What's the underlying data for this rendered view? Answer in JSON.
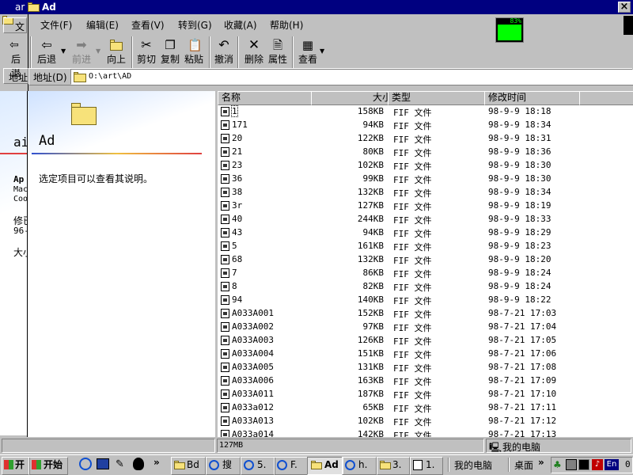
{
  "titlebar": {
    "back_window_title": "ar",
    "title": "Ad",
    "close_glyph": "×"
  },
  "menu": [
    "文",
    "文件(F)",
    "编辑(E)",
    "查看(V)",
    "转到(G)",
    "收藏(A)",
    "帮助(H)"
  ],
  "meter": {
    "value": "83%"
  },
  "toolbar": {
    "left_partial": "后退",
    "buttons": [
      "后退",
      "前进",
      "向上",
      "剪切",
      "复制",
      "粘贴",
      "撤消",
      "删除",
      "属性",
      "查看"
    ]
  },
  "addressbar": {
    "left_label": "地址",
    "label": "地址(D)",
    "path": "O:\\art\\AD"
  },
  "back_window_panel": {
    "title": "ai",
    "line1": "Ap",
    "line2": "Mac",
    "line3": "Coo",
    "line4": "修已",
    "line5": "96-",
    "line6": "大小"
  },
  "left_panel": {
    "folder_title": "Ad",
    "hint": "选定项目可以查看其说明。"
  },
  "columns": {
    "name": "名称",
    "size": "大小",
    "type": "类型",
    "modified": "修改时间"
  },
  "files": [
    {
      "name": "1",
      "size": "158KB",
      "type": "FIF 文件",
      "date": "98-9-9 18:18"
    },
    {
      "name": "171",
      "size": "94KB",
      "type": "FIF 文件",
      "date": "98-9-9 18:34"
    },
    {
      "name": "20",
      "size": "122KB",
      "type": "FIF 文件",
      "date": "98-9-9 18:31"
    },
    {
      "name": "21",
      "size": "80KB",
      "type": "FIF 文件",
      "date": "98-9-9 18:36"
    },
    {
      "name": "23",
      "size": "102KB",
      "type": "FIF 文件",
      "date": "98-9-9 18:30"
    },
    {
      "name": "36",
      "size": "99KB",
      "type": "FIF 文件",
      "date": "98-9-9 18:30"
    },
    {
      "name": "38",
      "size": "132KB",
      "type": "FIF 文件",
      "date": "98-9-9 18:34"
    },
    {
      "name": "3r",
      "size": "127KB",
      "type": "FIF 文件",
      "date": "98-9-9 18:19"
    },
    {
      "name": "40",
      "size": "244KB",
      "type": "FIF 文件",
      "date": "98-9-9 18:33"
    },
    {
      "name": "43",
      "size": "94KB",
      "type": "FIF 文件",
      "date": "98-9-9 18:29"
    },
    {
      "name": "5",
      "size": "161KB",
      "type": "FIF 文件",
      "date": "98-9-9 18:23"
    },
    {
      "name": "68",
      "size": "132KB",
      "type": "FIF 文件",
      "date": "98-9-9 18:20"
    },
    {
      "name": "7",
      "size": "86KB",
      "type": "FIF 文件",
      "date": "98-9-9 18:24"
    },
    {
      "name": "8",
      "size": "82KB",
      "type": "FIF 文件",
      "date": "98-9-9 18:24"
    },
    {
      "name": "94",
      "size": "140KB",
      "type": "FIF 文件",
      "date": "98-9-9 18:22"
    },
    {
      "name": "A033A001",
      "size": "152KB",
      "type": "FIF 文件",
      "date": "98-7-21 17:03"
    },
    {
      "name": "A033A002",
      "size": "97KB",
      "type": "FIF 文件",
      "date": "98-7-21 17:04"
    },
    {
      "name": "A033A003",
      "size": "126KB",
      "type": "FIF 文件",
      "date": "98-7-21 17:05"
    },
    {
      "name": "A033A004",
      "size": "151KB",
      "type": "FIF 文件",
      "date": "98-7-21 17:06"
    },
    {
      "name": "A033A005",
      "size": "131KB",
      "type": "FIF 文件",
      "date": "98-7-21 17:08"
    },
    {
      "name": "A033A006",
      "size": "163KB",
      "type": "FIF 文件",
      "date": "98-7-21 17:09"
    },
    {
      "name": "A033A011",
      "size": "187KB",
      "type": "FIF 文件",
      "date": "98-7-21 17:10"
    },
    {
      "name": "A033a012",
      "size": "65KB",
      "type": "FIF 文件",
      "date": "98-7-21 17:11"
    },
    {
      "name": "A033A013",
      "size": "102KB",
      "type": "FIF 文件",
      "date": "98-7-21 17:12"
    },
    {
      "name": "A033a014",
      "size": "142KB",
      "type": "FIF 文件",
      "date": "98-7-21 17:13"
    }
  ],
  "statusbar": {
    "size": "127MB",
    "location": "我的电脑"
  },
  "taskbar": {
    "start_partial": "开",
    "start": "开始",
    "quicklaunch_more": "»",
    "buttons": [
      "Bd",
      "搜",
      "5.",
      "F.",
      "Ad",
      "h.",
      "3.",
      "1."
    ],
    "mycomputer": "我的电脑",
    "desktop": "桌面",
    "desktop_more": "»",
    "tray_lang": "En",
    "clock": "0"
  },
  "colors": {
    "titlebar": "#000080",
    "meter": "#00ff00",
    "folder": "#f7e27a"
  }
}
